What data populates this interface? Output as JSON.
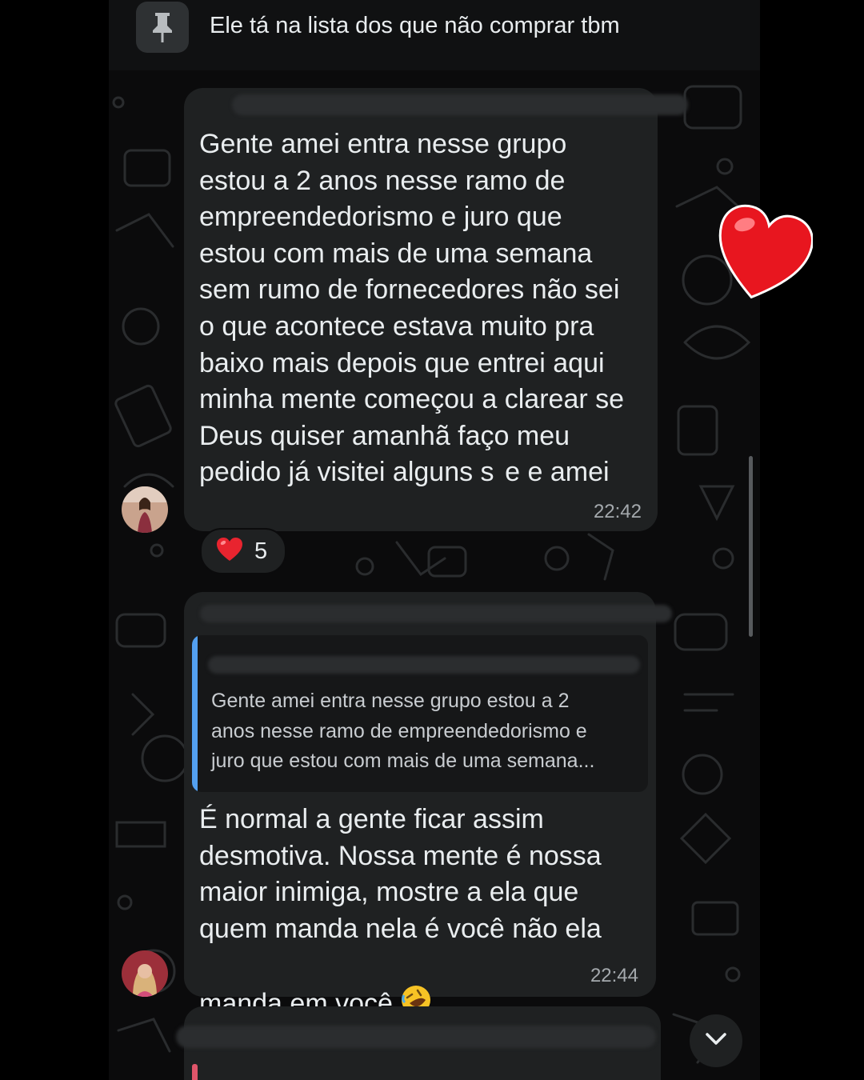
{
  "pinned": {
    "icon": "pin-icon",
    "text": "Ele tá na lista dos que não comprar tbm"
  },
  "messages": [
    {
      "text": "Gente amei entra nesse grupo\nestou a 2 anos nesse ramo de\nempreendedorismo e juro que\nestou com mais de uma semana\nsem rumo de fornecedores não sei\no que acontece estava muito pra\nbaixo mais depois que entrei aqui\nminha mente começou a clarear se\nDeus quiser amanhã faço meu\npedido já visitei alguns s  e e amei",
      "time": "22:42",
      "reaction": {
        "emoji": "heart-emoji",
        "count": "5"
      }
    },
    {
      "quote_text": "Gente amei entra nesse grupo estou a 2\nanos nesse ramo de empreendedorismo e\njuro que estou com mais de uma semana...",
      "text": "É normal a gente ficar assim\ndesmotiva. Nossa mente é nossa\nmaior inimiga, mostre a ela que\nquem manda nela é você não ela\nmanda em você",
      "emoji": "rolling-on-floor-laughing-emoji",
      "time": "22:44"
    }
  ],
  "colors": {
    "bubble": "#1f2122",
    "quote_bar": "#53a0f0",
    "heart": "#e8242f",
    "text": "#e9edef",
    "timestamp": "#a4a9ad"
  }
}
